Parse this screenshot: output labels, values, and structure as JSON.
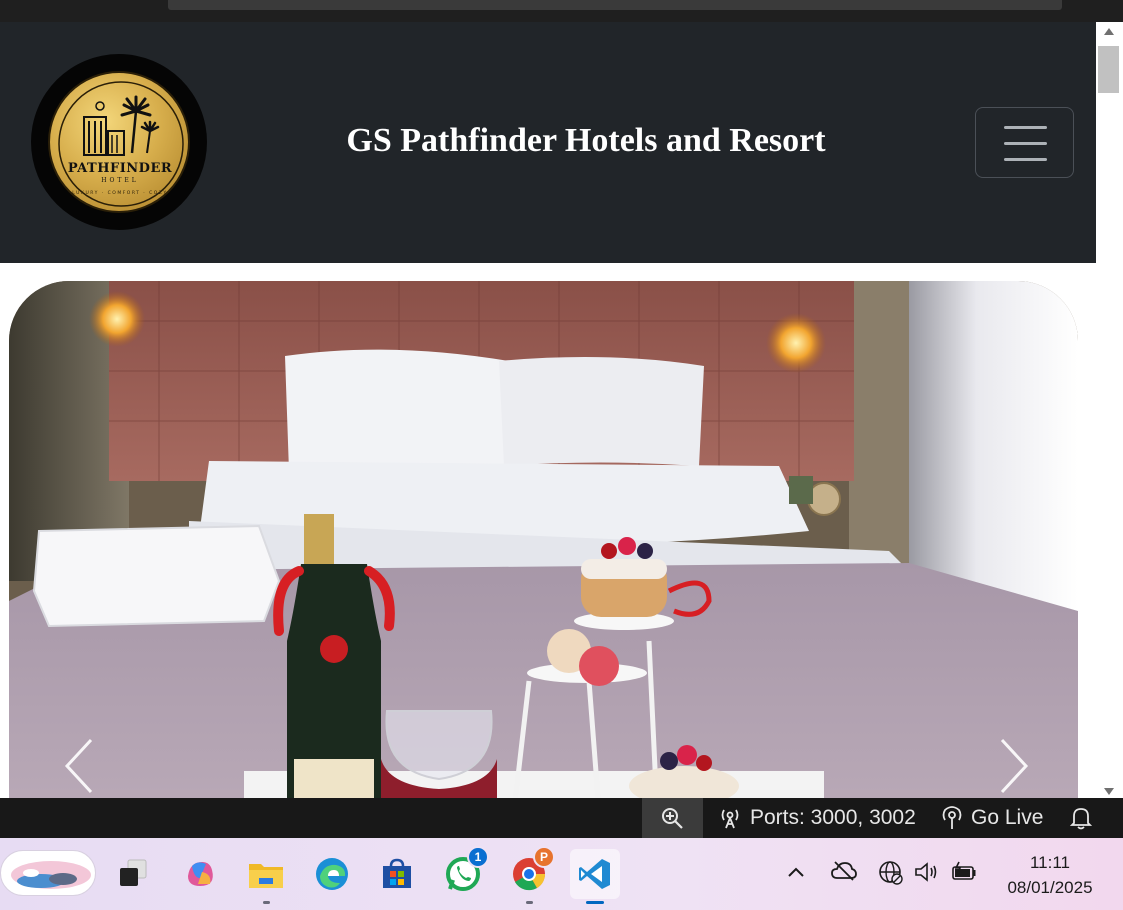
{
  "site": {
    "title": "GS Pathfinder Hotels and Resort",
    "logo": {
      "brand": "PATHFINDER",
      "sub": "HOTEL",
      "tagline": "LUXURY · COMFORT · COZY"
    }
  },
  "status_bar": {
    "ports_label": "Ports: 3000, 3002",
    "go_live_label": "Go Live"
  },
  "taskbar": {
    "whatsapp_badge": "1",
    "chrome_profile_badge": "P",
    "time": "11:11",
    "date": "08/01/2025"
  },
  "colors": {
    "header_bg": "#212529",
    "status_bar_bg": "#181818",
    "vscode_blue": "#0067c0"
  }
}
